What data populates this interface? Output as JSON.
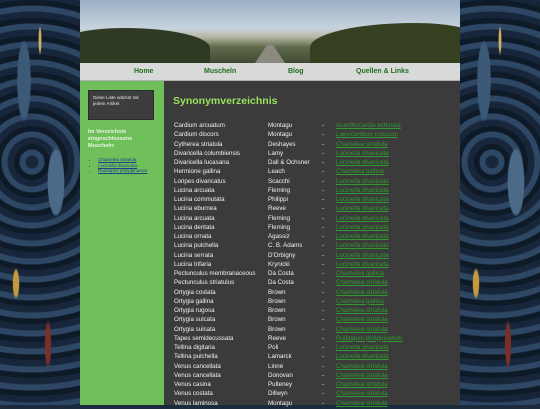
{
  "nav": {
    "items": [
      "Home",
      "Muscheln",
      "Blog",
      "Quellen & Links"
    ]
  },
  "sidebar": {
    "notice": "Diese Liste wächst mit jedem Artikel.",
    "heading": "Im Verzeichnis eingeschlossene Muscheln:",
    "links": [
      "Chamelea striatula",
      "Lucinella divaricata",
      "Ruditapes philippinarum"
    ]
  },
  "main": {
    "title": "Synonymverzeichnis",
    "rows": [
      {
        "name": "Cardium arcuatum",
        "author": "Montagu",
        "sep": "-",
        "link": "Acanthocardia echinata"
      },
      {
        "name": "Cardium discors",
        "author": "Montagu",
        "sep": "-",
        "link": "Laevicardium crassum"
      },
      {
        "name": "Cytherea striatula",
        "author": "Deshayes",
        "sep": "-",
        "link": "Chamelea striatula"
      },
      {
        "name": "Divaricella columbiensis",
        "author": "Lamy",
        "sep": "-",
        "link": "Lucinella divaricata"
      },
      {
        "name": "Divaricella lucasana",
        "author": "Dall & Ochsner",
        "sep": "-",
        "link": "Lucinella divaricata"
      },
      {
        "name": "Hermione gallina",
        "author": "Leach",
        "sep": "-",
        "link": "Chamelea gallina"
      },
      {
        "name": "Loripes divaricatus",
        "author": "Scacchi",
        "sep": "-",
        "link": "Lucinella divaricata"
      },
      {
        "name": "Lucina arcuata",
        "author": "Fleming",
        "sep": "-",
        "link": "Lucinella divaricata"
      },
      {
        "name": "Lucina commutata",
        "author": "Philippi",
        "sep": "-",
        "link": "Lucinella divaricata"
      },
      {
        "name": "Lucina eburnea",
        "author": "Reeve",
        "sep": "-",
        "link": "Lucinella divaricata"
      },
      {
        "name": "Lucina arcuata",
        "author": "Fleming",
        "sep": "-",
        "link": "Lucinella divaricata"
      },
      {
        "name": "Lucina dentata",
        "author": "Fleming",
        "sep": "-",
        "link": "Lucinella divaricata"
      },
      {
        "name": "Lucina ornata",
        "author": "Agassiz",
        "sep": "-",
        "link": "Lucinella divaricata"
      },
      {
        "name": "Lucina pulchella",
        "author": "C. B. Adams",
        "sep": "-",
        "link": "Lucinella divaricata"
      },
      {
        "name": "Lucina serrata",
        "author": "D'Orbigny",
        "sep": "-",
        "link": "Lucinella divaricata"
      },
      {
        "name": "Lucina trifaria",
        "author": "Krynicki",
        "sep": "-",
        "link": "Lucinella divaricata"
      },
      {
        "name": "Pectunculus membranaceous",
        "author": "Da Costa",
        "sep": "-",
        "link": "Chamelea gallina"
      },
      {
        "name": "Pectunculus striatulus",
        "author": "Da Costa",
        "sep": "-",
        "link": "Chamelea striatula"
      },
      {
        "name": "Ortygia costata",
        "author": "Brown",
        "sep": "-",
        "link": "Chamelea striatula"
      },
      {
        "name": "Ortygia gallina",
        "author": "Brown",
        "sep": "-",
        "link": "Chamelea gallina"
      },
      {
        "name": "Ortygia rugosa",
        "author": "Brown",
        "sep": "-",
        "link": "Chamelea striatula"
      },
      {
        "name": "Ortygia sulcata",
        "author": "Brown",
        "sep": "-",
        "link": "Chamelea striatula"
      },
      {
        "name": "Ortygia sulcata",
        "author": "Brown",
        "sep": "-",
        "link": "Chamelea striatula"
      },
      {
        "name": "Tapes semidecussata",
        "author": "Reeve",
        "sep": "-",
        "link": "Ruditapes philippinarum"
      },
      {
        "name": "Tellina digitaria",
        "author": "Poli",
        "sep": "-",
        "link": "Lucinella divaricata"
      },
      {
        "name": "Tellina pulchella",
        "author": "Lamarck",
        "sep": "-",
        "link": "Lucinella divaricata"
      },
      {
        "name": "Venus cancellata",
        "author": "Linné",
        "sep": "-",
        "link": "Chamelea striatula"
      },
      {
        "name": "Venus cancellata",
        "author": "Donovan",
        "sep": "-",
        "link": "Chamelea striatula"
      },
      {
        "name": "Venus casina",
        "author": "Pulteney",
        "sep": "-",
        "link": "Chamelea striatula"
      },
      {
        "name": "Venus costata",
        "author": "Dillwyn",
        "sep": "-",
        "link": "Chamelea striatula"
      },
      {
        "name": "Venus laminosa",
        "author": "Montagu",
        "sep": "-",
        "link": "Chamelea striatula"
      }
    ]
  }
}
